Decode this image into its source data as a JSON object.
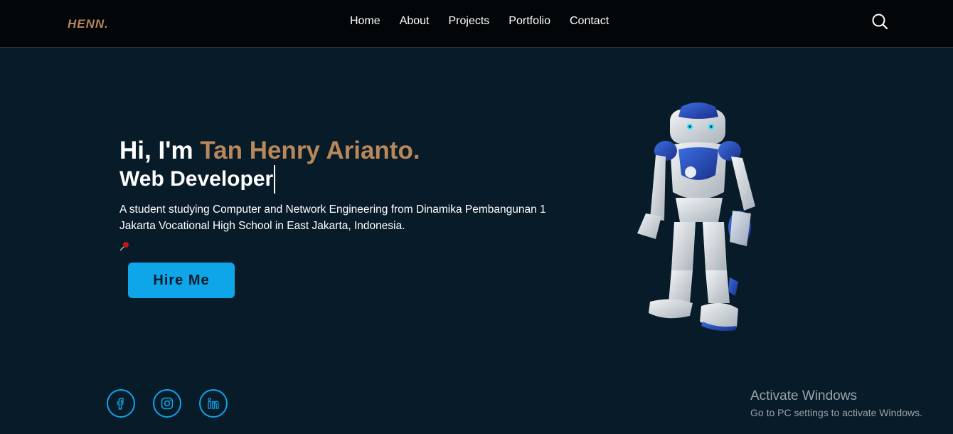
{
  "colors": {
    "accent": "#0ea5e9",
    "name_highlight": "#b8875a",
    "background": "#081b29",
    "header": "#020608"
  },
  "header": {
    "logo": "HENN.",
    "nav": [
      "Home",
      "About",
      "Projects",
      "Portfolio",
      "Contact"
    ],
    "search_icon": "search-icon"
  },
  "hero": {
    "greeting_prefix": "Hi, I'm ",
    "name": "Tan Henry Arianto.",
    "role": "Web Developer",
    "description": "A student studying Computer and Network Engineering from Dinamika Pembangunan 1 Jakarta Vocational High School in East Jakarta, Indonesia.",
    "pin_icon": "pushpin-icon",
    "cta": "Hire Me",
    "image": "robot-image"
  },
  "socials": [
    "facebook-icon",
    "instagram-icon",
    "linkedin-icon"
  ],
  "watermark": {
    "title": "Activate Windows",
    "subtitle": "Go to PC settings to activate Windows."
  }
}
